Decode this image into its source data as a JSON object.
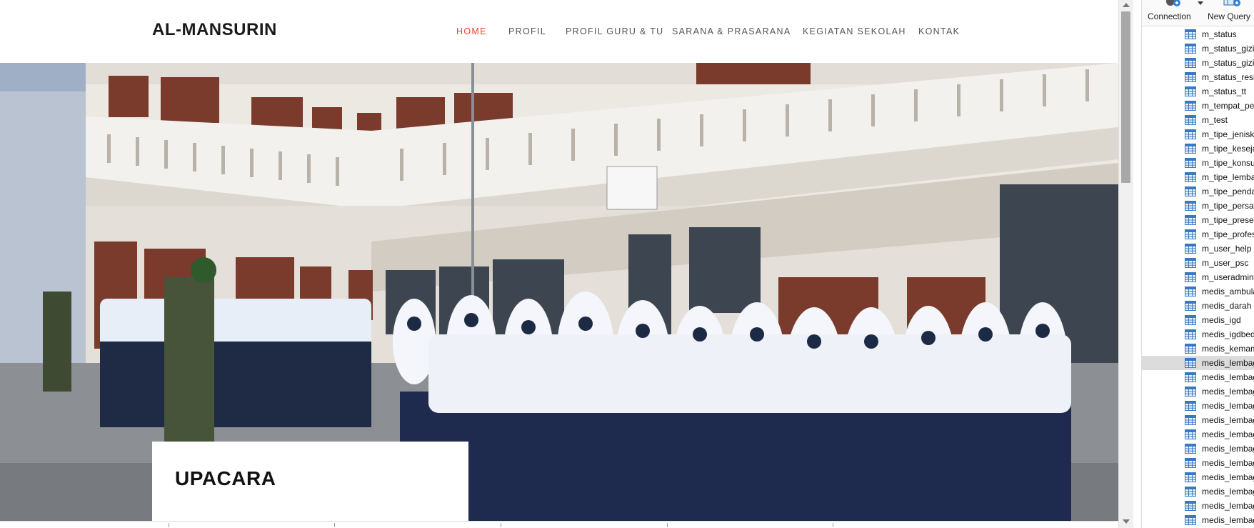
{
  "site": {
    "logo": "AL-MANSURIN",
    "nav": [
      {
        "label": "HOME",
        "active": true
      },
      {
        "label": "PROFIL",
        "active": false
      },
      {
        "label": "PROFIL GURU & TU",
        "active": false
      },
      {
        "label": "SARANA & PRASARANA",
        "active": false
      },
      {
        "label": "KEGIATAN SEKOLAH",
        "active": false
      },
      {
        "label": "KONTAK",
        "active": false
      }
    ],
    "hero_caption": "UPACARA",
    "accent_color": "#e8472c"
  },
  "explorer": {
    "toolbar": {
      "connection_label": "Connection",
      "new_query_label": "New Query"
    },
    "tables": [
      "m_status",
      "m_status_gizi_",
      "m_status_gizi_",
      "m_status_resik",
      "m_status_tt",
      "m_tempat_per",
      "m_test",
      "m_tipe_jenisk",
      "m_tipe_keseja",
      "m_tipe_konsu",
      "m_tipe_lemba",
      "m_tipe_penda",
      "m_tipe_persali",
      "m_tipe_preser",
      "m_tipe_profes",
      "m_user_help",
      "m_user_psc",
      "m_useradmin",
      "medis_ambula",
      "medis_darah",
      "medis_igd",
      "medis_igdbed",
      "medis_kemam",
      "medis_lembag",
      "medis_lembag",
      "medis_lembag",
      "medis_lembag",
      "medis_lembag",
      "medis_lembag",
      "medis_lembag",
      "medis_lembag",
      "medis_lembag",
      "medis_lembag",
      "medis_lembag",
      "medis_lembag"
    ],
    "selected_index": 23
  }
}
